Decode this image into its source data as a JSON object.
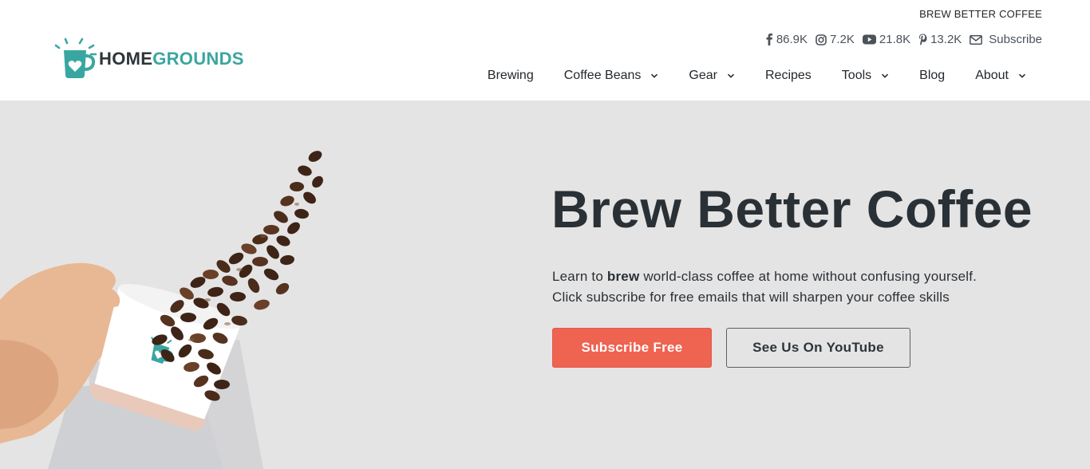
{
  "header": {
    "tagline": "BREW BETTER COFFEE",
    "logo": {
      "home": "HOME",
      "grounds": "GROUNDS",
      "icon": "mug-heart-icon"
    },
    "social": [
      {
        "icon": "facebook-icon",
        "count": "86.9K"
      },
      {
        "icon": "instagram-icon",
        "count": "7.2K"
      },
      {
        "icon": "youtube-icon",
        "count": "21.8K"
      },
      {
        "icon": "pinterest-icon",
        "count": "13.2K"
      },
      {
        "icon": "mail-icon",
        "label": "Subscribe"
      }
    ],
    "nav": [
      {
        "label": "Brewing",
        "dropdown": false
      },
      {
        "label": "Coffee Beans",
        "dropdown": true
      },
      {
        "label": "Gear",
        "dropdown": true
      },
      {
        "label": "Recipes",
        "dropdown": false
      },
      {
        "label": "Tools",
        "dropdown": true
      },
      {
        "label": "Blog",
        "dropdown": false
      },
      {
        "label": "About",
        "dropdown": true
      }
    ]
  },
  "hero": {
    "title": "Brew Better Coffee",
    "text_part1": "Learn to ",
    "text_bold": "brew",
    "text_part2": " world-class coffee at home without confusing yourself.",
    "text_line2": "Click subscribe for free emails that will sharpen your coffee skills",
    "primary_button": "Subscribe Free",
    "secondary_button": "See Us On YouTube"
  },
  "colors": {
    "accent": "#ef6351",
    "brand_teal": "#3aa6a1",
    "hero_bg": "#e4e4e4",
    "text_dark": "#2a3136"
  }
}
